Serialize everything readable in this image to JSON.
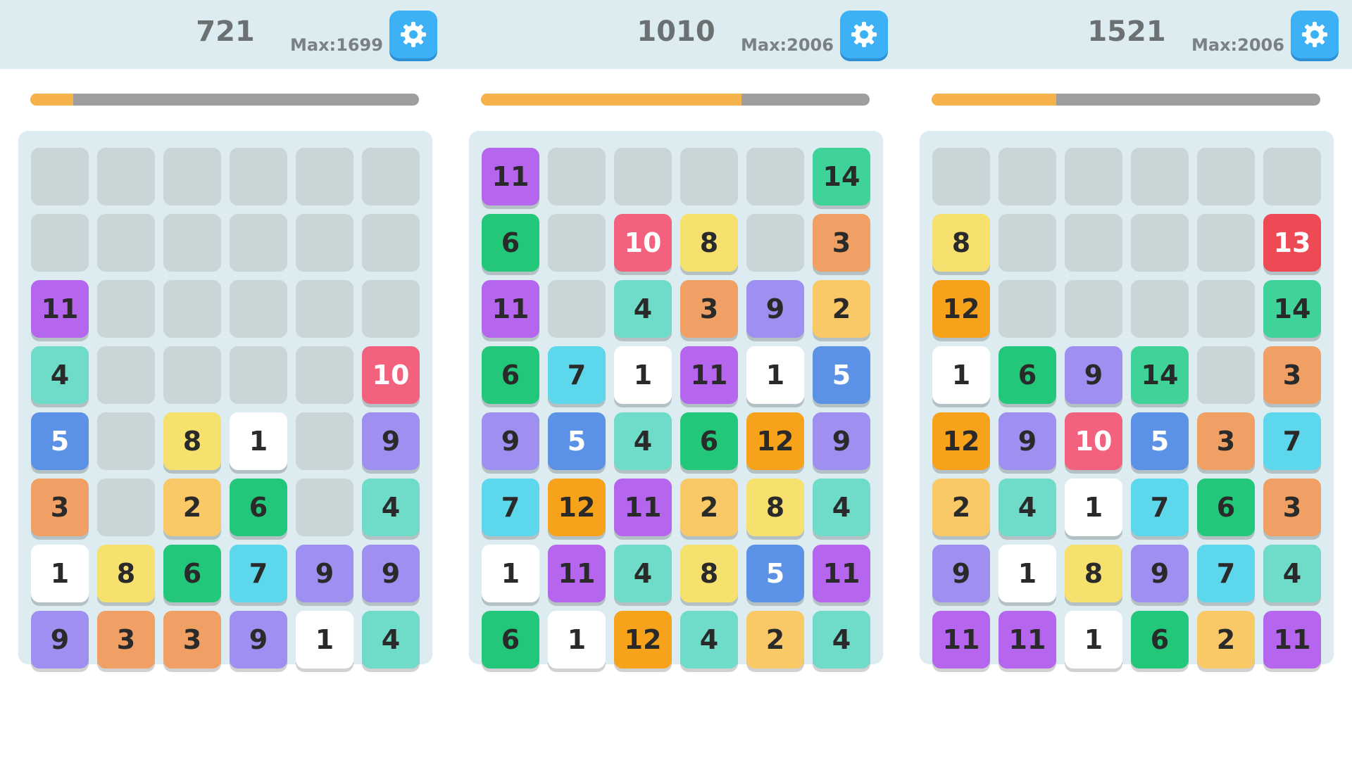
{
  "tile_colors": {
    "1": "#ffffff",
    "2": "#f9c968",
    "3": "#f0a064",
    "4": "#6fdbc9",
    "5": "#5c92e6",
    "6": "#23c77a",
    "7": "#5cd7ec",
    "8": "#f6e06e",
    "9": "#9e8ff0",
    "10": "#f2617d",
    "11": "#b565ee",
    "12": "#f7a21b",
    "13": "#ee4a56",
    "14": "#3fd39a"
  },
  "white_text_values": [
    "5",
    "10",
    "13"
  ],
  "icons": {
    "settings": "gear-icon"
  },
  "boards": [
    {
      "score": "721",
      "max": "Max:1699",
      "progress": 0.11,
      "grid": [
        [
          "",
          "",
          "",
          "",
          "",
          ""
        ],
        [
          "",
          "",
          "",
          "",
          "",
          ""
        ],
        [
          "11",
          "",
          "",
          "",
          "",
          ""
        ],
        [
          "4",
          "",
          "",
          "",
          "",
          "10"
        ],
        [
          "5",
          "",
          "8",
          "1",
          "",
          "9"
        ],
        [
          "3",
          "",
          "2",
          "6",
          "",
          "4"
        ],
        [
          "1",
          "8",
          "6",
          "7",
          "9",
          "9"
        ],
        [
          "9",
          "3",
          "3",
          "9",
          "1",
          "4"
        ]
      ]
    },
    {
      "score": "1010",
      "max": "Max:2006",
      "progress": 0.67,
      "grid": [
        [
          "11",
          "",
          "",
          "",
          "",
          "14"
        ],
        [
          "6",
          "",
          "10",
          "8",
          "",
          "3"
        ],
        [
          "11",
          "",
          "4",
          "3",
          "9",
          "2"
        ],
        [
          "6",
          "7",
          "1",
          "11",
          "1",
          "5"
        ],
        [
          "9",
          "5",
          "4",
          "6",
          "12",
          "9"
        ],
        [
          "7",
          "12",
          "11",
          "2",
          "8",
          "4"
        ],
        [
          "1",
          "11",
          "4",
          "8",
          "5",
          "11"
        ],
        [
          "6",
          "1",
          "12",
          "4",
          "2",
          "4"
        ]
      ]
    },
    {
      "score": "1521",
      "max": "Max:2006",
      "progress": 0.32,
      "grid": [
        [
          "",
          "",
          "",
          "",
          "",
          ""
        ],
        [
          "8",
          "",
          "",
          "",
          "",
          "13"
        ],
        [
          "12",
          "",
          "",
          "",
          "",
          "14"
        ],
        [
          "1",
          "6",
          "9",
          "14",
          "",
          "3"
        ],
        [
          "12",
          "9",
          "10",
          "5",
          "3",
          "7"
        ],
        [
          "2",
          "4",
          "1",
          "7",
          "6",
          "3"
        ],
        [
          "9",
          "1",
          "8",
          "9",
          "7",
          "4"
        ],
        [
          "11",
          "11",
          "1",
          "6",
          "2",
          "11"
        ]
      ]
    }
  ]
}
